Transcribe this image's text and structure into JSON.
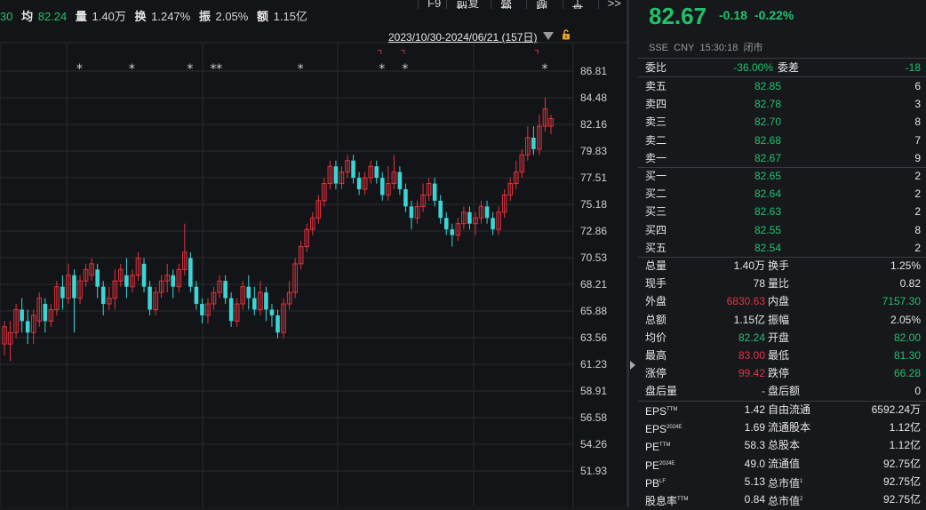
{
  "info_bar": {
    "prefix": "30",
    "avg_label": "均",
    "avg_value": "82.24",
    "vol_label": "量",
    "vol_value": "1.40万",
    "turnover_label": "换",
    "turnover_value": "1.247%",
    "amp_label": "振",
    "amp_value": "2.05%",
    "amount_label": "额",
    "amount_value": "1.15亿"
  },
  "toolbar": [
    "F9",
    "前复权",
    "叠加",
    "画线",
    "工具",
    ">>"
  ],
  "range_label": "2023/10/30-2024/06/21 (157日)",
  "y_axis_ticks": [
    "86.81",
    "84.48",
    "82.16",
    "79.83",
    "77.51",
    "75.18",
    "72.86",
    "70.53",
    "68.21",
    "65.88",
    "63.56",
    "61.23",
    "58.91",
    "56.58",
    "54.26",
    "51.93"
  ],
  "markers": {
    "star": "*",
    "flag": "⌝"
  },
  "colors": {
    "up": "#e5323e",
    "down": "#3ad6d6",
    "green": "#1fc26b",
    "bg": "#131417"
  },
  "quote": {
    "price": "82.67",
    "change": "-0.18",
    "change_pct": "-0.22%",
    "exchange": "SSE",
    "currency": "CNY",
    "time": "15:30:18",
    "status": "闭市"
  },
  "order_book": {
    "wei_bi_label": "委比",
    "wei_bi": "-36.00%",
    "wei_cha_label": "委差",
    "wei_cha": "-18",
    "asks": [
      {
        "label": "卖五",
        "price": "82.85",
        "vol": "6"
      },
      {
        "label": "卖四",
        "price": "82.78",
        "vol": "3"
      },
      {
        "label": "卖三",
        "price": "82.70",
        "vol": "8"
      },
      {
        "label": "卖二",
        "price": "82.68",
        "vol": "7"
      },
      {
        "label": "卖一",
        "price": "82.67",
        "vol": "9"
      }
    ],
    "bids": [
      {
        "label": "买一",
        "price": "82.65",
        "vol": "2"
      },
      {
        "label": "买二",
        "price": "82.64",
        "vol": "2"
      },
      {
        "label": "买三",
        "price": "82.63",
        "vol": "2"
      },
      {
        "label": "买四",
        "price": "82.55",
        "vol": "8"
      },
      {
        "label": "买五",
        "price": "82.54",
        "vol": "2"
      }
    ]
  },
  "stats": [
    {
      "l1": "总量",
      "v1": "1.40万",
      "l2": "换手",
      "v2": "1.25%"
    },
    {
      "l1": "现手",
      "v1": "78",
      "l2": "量比",
      "v2": "0.82"
    },
    {
      "l1": "外盘",
      "v1": "6830.63",
      "l2": "内盘",
      "v2": "7157.30"
    },
    {
      "l1": "总额",
      "v1": "1.15亿",
      "l2": "振幅",
      "v2": "2.05%"
    },
    {
      "l1": "均价",
      "v1": "82.24",
      "l2": "开盘",
      "v2": "82.00"
    },
    {
      "l1": "最高",
      "v1": "83.00",
      "l2": "最低",
      "v2": "81.30"
    },
    {
      "l1": "涨停",
      "v1": "99.42",
      "l2": "跌停",
      "v2": "66.28"
    },
    {
      "l1": "盘后量",
      "v1": "-",
      "l2": "盘后额",
      "v2": "0"
    }
  ],
  "fundamentals": [
    {
      "l1": "EPS",
      "s1": "TTM",
      "v1": "1.42",
      "l2": "自由流通",
      "s2": "",
      "v2": "6592.24万"
    },
    {
      "l1": "EPS",
      "s1": "2024E",
      "v1": "1.69",
      "l2": "流通股本",
      "s2": "",
      "v2": "1.12亿"
    },
    {
      "l1": "PE",
      "s1": "TTM",
      "v1": "58.3",
      "l2": "总股本",
      "s2": "",
      "v2": "1.12亿"
    },
    {
      "l1": "PE",
      "s1": "2024E",
      "v1": "49.0",
      "l2": "流通值",
      "s2": "",
      "v2": "92.75亿"
    },
    {
      "l1": "PB",
      "s1": "LF",
      "v1": "5.13",
      "l2": "总市值",
      "s2": "1",
      "v2": "92.75亿"
    },
    {
      "l1": "股息率",
      "s1": "TTM",
      "v1": "0.84",
      "l2": "总市值",
      "s2": "2",
      "v2": "92.75亿"
    }
  ],
  "chart_data": {
    "type": "candlestick",
    "y_ticks": [
      86.81,
      84.48,
      82.16,
      79.83,
      77.51,
      75.18,
      72.86,
      70.53,
      68.21,
      65.88,
      63.56,
      61.23,
      58.91,
      56.58,
      54.26,
      51.93
    ],
    "candles": [
      [
        63,
        64.5,
        62,
        65
      ],
      [
        63,
        64,
        61.5,
        65
      ],
      [
        64,
        66,
        63.5,
        66.5
      ],
      [
        66,
        65,
        64,
        67
      ],
      [
        65,
        64,
        63,
        66
      ],
      [
        64,
        65.5,
        63,
        66
      ],
      [
        65,
        67,
        64.5,
        67.5
      ],
      [
        66.5,
        65,
        64,
        67
      ],
      [
        65,
        66,
        64.5,
        66.5
      ],
      [
        66,
        68,
        65.5,
        68.5
      ],
      [
        68,
        67,
        66,
        69
      ],
      [
        67,
        69,
        66.5,
        70
      ],
      [
        69,
        67,
        64,
        69.5
      ],
      [
        67,
        68.5,
        66.5,
        69
      ],
      [
        68.5,
        69.5,
        68,
        70
      ],
      [
        69,
        70,
        68.5,
        70.5
      ],
      [
        69.5,
        68,
        67,
        70
      ],
      [
        68,
        66.5,
        65.5,
        68.5
      ],
      [
        66.5,
        67,
        66,
        68
      ],
      [
        67,
        68.5,
        66,
        69.5
      ],
      [
        68.5,
        69.5,
        68,
        70
      ],
      [
        69,
        68,
        67,
        70.5
      ],
      [
        68,
        69,
        67.5,
        69.5
      ],
      [
        69,
        70.5,
        68.5,
        71
      ],
      [
        70,
        68,
        67.5,
        70.5
      ],
      [
        68,
        66,
        65.5,
        68.5
      ],
      [
        66,
        67.5,
        65.5,
        68
      ],
      [
        67.5,
        68.5,
        67,
        69
      ],
      [
        68.5,
        69,
        67.5,
        70
      ],
      [
        69,
        68,
        67,
        69.5
      ],
      [
        68,
        69.5,
        67.5,
        70
      ],
      [
        69.5,
        71,
        69,
        73.5
      ],
      [
        70.5,
        68,
        67.5,
        71
      ],
      [
        68,
        66.5,
        66,
        68.5
      ],
      [
        66.5,
        65.5,
        64.8,
        67
      ],
      [
        65.5,
        66.5,
        64.8,
        67
      ],
      [
        66.5,
        67.5,
        66,
        68
      ],
      [
        67.5,
        68.5,
        67,
        69
      ],
      [
        68.5,
        67,
        66.5,
        69
      ],
      [
        67,
        65,
        64.5,
        67.5
      ],
      [
        65,
        66.5,
        64.5,
        67
      ],
      [
        66.5,
        68,
        66,
        68.5
      ],
      [
        68,
        67,
        66,
        69
      ],
      [
        67,
        66,
        65.5,
        68
      ],
      [
        66,
        67.5,
        65.5,
        68.5
      ],
      [
        67.5,
        66,
        65,
        68
      ],
      [
        66,
        65.5,
        64.5,
        66.5
      ],
      [
        65.5,
        64,
        63.5,
        66
      ],
      [
        64,
        66.5,
        63.5,
        67
      ],
      [
        66.5,
        67.5,
        66,
        68.5
      ],
      [
        67.5,
        70,
        67,
        70.5
      ],
      [
        70,
        71.5,
        69.5,
        72
      ],
      [
        71.5,
        73,
        71,
        73.5
      ],
      [
        73,
        74,
        72.5,
        74.5
      ],
      [
        74,
        75.5,
        73.5,
        76
      ],
      [
        75.5,
        77,
        75,
        77.5
      ],
      [
        77,
        78.5,
        76.5,
        79
      ],
      [
        78.5,
        77,
        76.5,
        79
      ],
      [
        77,
        78,
        76.5,
        78.5
      ],
      [
        78,
        79,
        77.5,
        79.5
      ],
      [
        79,
        77.5,
        77,
        79.5
      ],
      [
        77.5,
        76.5,
        76,
        78
      ],
      [
        76.5,
        77.5,
        76,
        78
      ],
      [
        77.5,
        78.5,
        77,
        79
      ],
      [
        78.5,
        77.5,
        77,
        79
      ],
      [
        77.5,
        76,
        75.5,
        78
      ],
      [
        76,
        77,
        75.5,
        78.5
      ],
      [
        77,
        78,
        76.5,
        79.5
      ],
      [
        78,
        76.5,
        76,
        78.5
      ],
      [
        76.5,
        75,
        74.5,
        77
      ],
      [
        75,
        74,
        73,
        75.5
      ],
      [
        74,
        75,
        73.5,
        75.5
      ],
      [
        75,
        76,
        74.5,
        77
      ],
      [
        76,
        77,
        75.5,
        77.5
      ],
      [
        77,
        75.5,
        75,
        77.5
      ],
      [
        75.5,
        74,
        73.5,
        76
      ],
      [
        74,
        73,
        72.5,
        74.5
      ],
      [
        73,
        72.5,
        71.5,
        73.5
      ],
      [
        72.5,
        73.5,
        72,
        74
      ],
      [
        73.5,
        74.5,
        73,
        75
      ],
      [
        74.5,
        73.5,
        73,
        75
      ],
      [
        73.5,
        74,
        72.5,
        74.5
      ],
      [
        74,
        75,
        73.5,
        75.5
      ],
      [
        75,
        74,
        73.5,
        75.5
      ],
      [
        74,
        73,
        72.5,
        74.5
      ],
      [
        73,
        74.5,
        72.5,
        75
      ],
      [
        74.5,
        76,
        74,
        76.5
      ],
      [
        76,
        77,
        75.5,
        77.5
      ],
      [
        77,
        78,
        76.5,
        79
      ],
      [
        78,
        79.5,
        77.5,
        80
      ],
      [
        79.5,
        81,
        79,
        82
      ],
      [
        81,
        80,
        79.5,
        82
      ],
      [
        80,
        82,
        79.5,
        83
      ],
      [
        82,
        83.5,
        81.5,
        84.5
      ],
      [
        82,
        82.67,
        81.3,
        83
      ]
    ]
  }
}
